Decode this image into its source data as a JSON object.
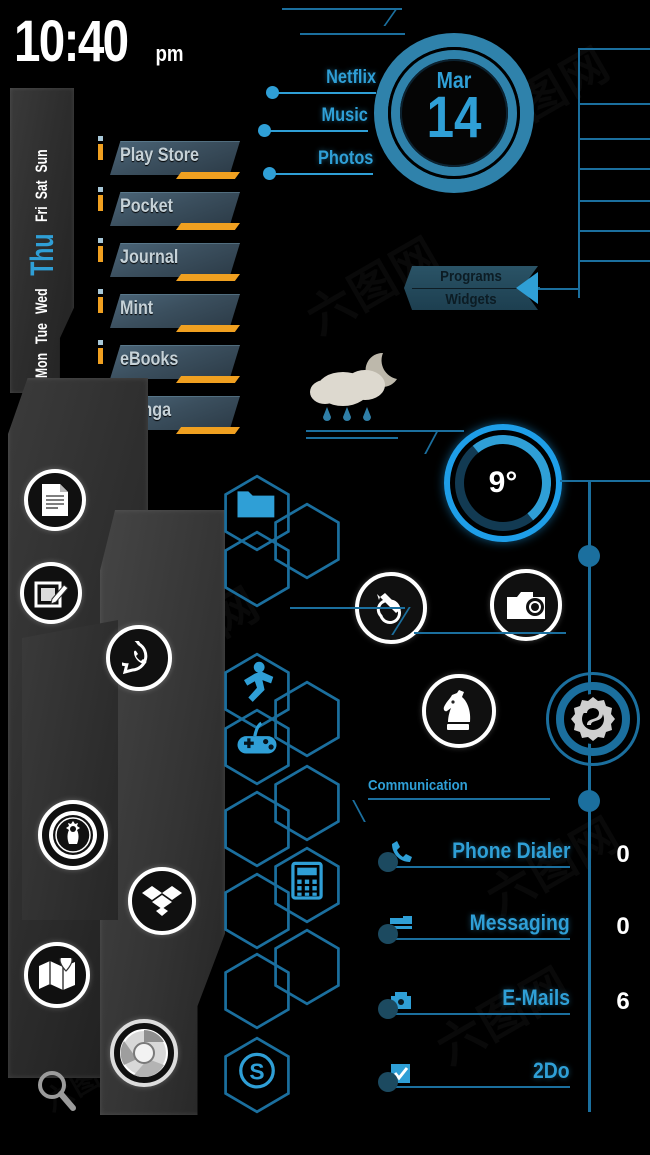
{
  "theme": {
    "accent_blue": "#2f9fd6",
    "bright_blue": "#1e9ee8",
    "dark_blue": "#1b6f9e",
    "orange": "#f0a020",
    "background": "#000000",
    "panel_gray": "#2e2e2e"
  },
  "clock": {
    "time": "10:40",
    "ampm": "pm"
  },
  "day_strip": {
    "days": [
      {
        "label": "Mon",
        "active": false
      },
      {
        "label": "Tue",
        "active": false
      },
      {
        "label": "Wed",
        "active": false
      },
      {
        "label": "Thu",
        "active": true
      },
      {
        "label": "Fri",
        "active": false
      },
      {
        "label": "Sat",
        "active": false
      },
      {
        "label": "Sun",
        "active": false
      }
    ]
  },
  "app_list": [
    {
      "label": "Play Store"
    },
    {
      "label": "Pocket"
    },
    {
      "label": "Journal"
    },
    {
      "label": "Mint"
    },
    {
      "label": "eBooks"
    },
    {
      "label": "Manga"
    }
  ],
  "top_links": [
    {
      "label": "Netflix"
    },
    {
      "label": "Music"
    },
    {
      "label": "Photos"
    }
  ],
  "date_widget": {
    "month": "Mar",
    "day": "14"
  },
  "mode_switch": {
    "primary": "Programs",
    "secondary": "Widgets",
    "arrow_icon": "arrow-left-icon"
  },
  "weather": {
    "icon": "night-rain-icon",
    "temperature": "9°",
    "gauge_percent": 30
  },
  "left_dock": [
    {
      "icon": "document-icon",
      "name": "documents"
    },
    {
      "icon": "notes-edit-icon",
      "name": "notes"
    },
    {
      "icon": "whatsapp-icon",
      "name": "whatsapp"
    },
    {
      "icon": "starbucks-icon",
      "name": "starbucks"
    },
    {
      "icon": "dropbox-icon",
      "name": "dropbox"
    },
    {
      "icon": "maps-icon",
      "name": "maps"
    },
    {
      "icon": "chrome-icon",
      "name": "chrome"
    },
    {
      "icon": "search-icon",
      "name": "search"
    }
  ],
  "center_icons": [
    {
      "icon": "adobe-creative-cloud-icon",
      "name": "adobe"
    },
    {
      "icon": "camera-icon",
      "name": "camera"
    },
    {
      "icon": "chess-knight-icon",
      "name": "chess"
    }
  ],
  "hex_grid": [
    {
      "icon": "folder-icon"
    },
    {
      "icon": "empty"
    },
    {
      "icon": "empty"
    },
    {
      "icon": "runner-icon"
    },
    {
      "icon": "empty"
    },
    {
      "icon": "gamepad-icon"
    },
    {
      "icon": "empty"
    },
    {
      "icon": "empty"
    },
    {
      "icon": "calculator-icon"
    },
    {
      "icon": "empty"
    },
    {
      "icon": "empty"
    },
    {
      "icon": "empty"
    },
    {
      "icon": "skype-icon"
    }
  ],
  "communication": {
    "heading": "Communication",
    "rows": [
      {
        "label": "Phone Dialer",
        "count": "0",
        "icon": "phone-icon"
      },
      {
        "label": "Messaging",
        "count": "0",
        "icon": "message-icon"
      },
      {
        "label": "E-Mails",
        "count": "6",
        "icon": "mail-icon"
      },
      {
        "label": "2Do",
        "count": "",
        "icon": "checkbox-icon"
      }
    ]
  },
  "settings": {
    "icon": "gear-icon",
    "label": "Settings"
  },
  "watermark": {
    "text": "六图网"
  }
}
